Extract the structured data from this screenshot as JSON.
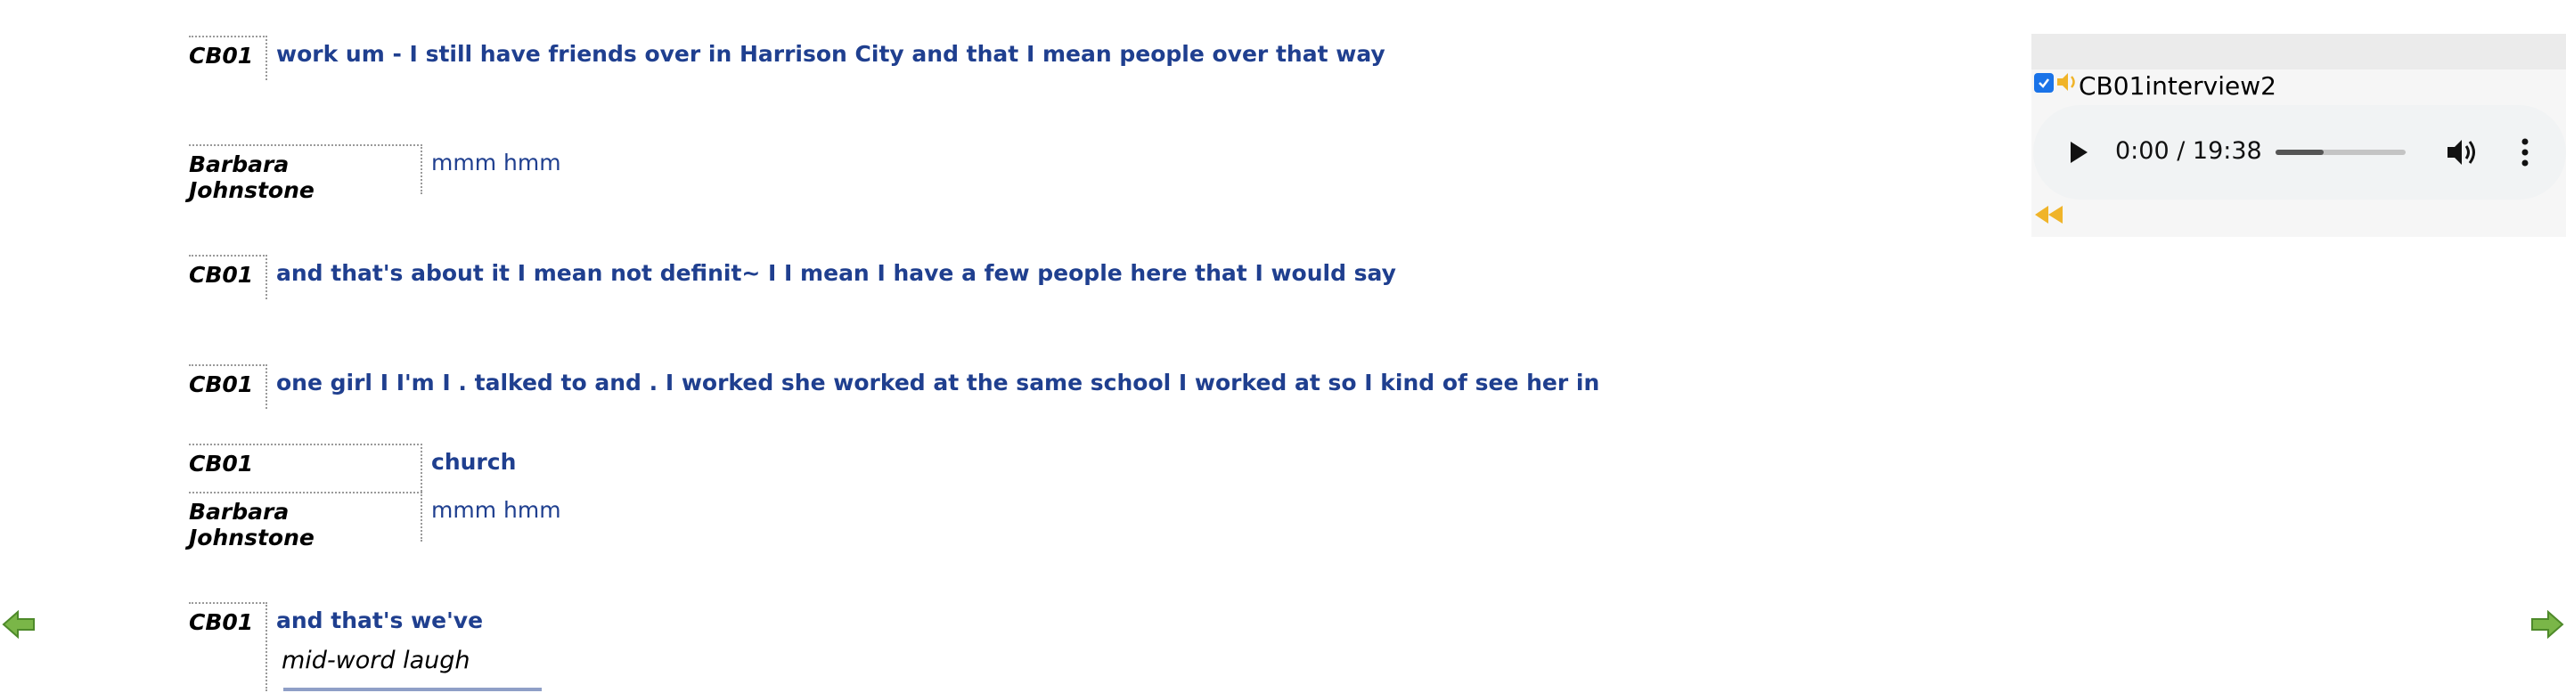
{
  "transcript": [
    {
      "speaker": "CB01",
      "text": "work um - I still have friends over in Harrison City and that I mean people over that way",
      "style": "bold"
    },
    {
      "speaker": "Barbara Johnstone",
      "text": "mmm hmm",
      "style": "plain"
    },
    {
      "speaker": "CB01",
      "text": "and that's about it I mean not definit~ I I mean I have a few people here that I would say",
      "style": "bold"
    },
    {
      "speaker": "CB01",
      "text": "one girl I I'm I . talked to and . I worked she worked at the same school I worked at so I kind of see her in",
      "style": "bold"
    },
    {
      "speaker": "CB01",
      "text": "church",
      "style": "bold"
    },
    {
      "speaker": "Barbara Johnstone",
      "text": "mmm hmm",
      "style": "plain"
    },
    {
      "speaker": "CB01",
      "text": "and that's we've",
      "style": "bold"
    }
  ],
  "annotations": {
    "mid_word_laugh": "mid-word laugh"
  },
  "player": {
    "checked": true,
    "recording_title": "CB01interview2",
    "time_display": "0:00 / 19:38",
    "volume_level": 0.37
  },
  "icons": {
    "prev": "left-arrow-icon",
    "next": "right-arrow-icon",
    "speaker": "speaker-icon",
    "rewind": "rewind-icon",
    "play": "play-icon",
    "volume": "volume-icon",
    "more": "more-vert-icon"
  },
  "colors": {
    "utterance": "#1f3f8f",
    "nav_arrow": "#7ab648",
    "accent_checkbox": "#1a73e8",
    "speaker_icon": "#f0b429"
  }
}
